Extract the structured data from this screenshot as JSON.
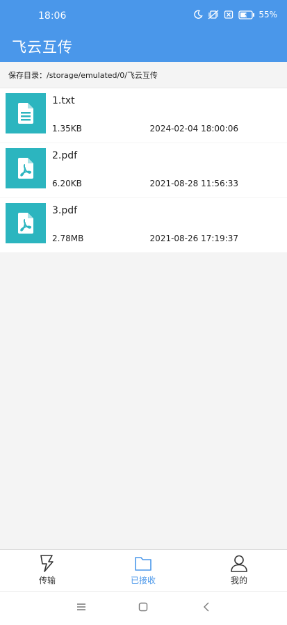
{
  "status_bar": {
    "time": "18:06",
    "battery_percent": "55%",
    "icons": [
      "moon-icon",
      "mute-vibrate-icon",
      "sim-off-icon",
      "battery-charging-icon"
    ]
  },
  "app": {
    "title": "飞云互传"
  },
  "save_directory": {
    "label": "保存目录：/storage/emulated/0/飞云互传"
  },
  "files": [
    {
      "name": "1.txt",
      "size": "1.35KB",
      "date": "2024-02-04 18:00:06",
      "icon": "text-file-icon"
    },
    {
      "name": "2.pdf",
      "size": "6.20KB",
      "date": "2021-08-28 11:56:33",
      "icon": "pdf-file-icon"
    },
    {
      "name": "3.pdf",
      "size": "2.78MB",
      "date": "2021-08-26 17:19:37",
      "icon": "pdf-file-icon"
    }
  ],
  "bottom_nav": {
    "items": [
      {
        "label": "传输",
        "icon": "lightning-icon",
        "active": false
      },
      {
        "label": "已接收",
        "icon": "folder-icon",
        "active": true
      },
      {
        "label": "我的",
        "icon": "person-icon",
        "active": false
      }
    ]
  },
  "colors": {
    "header": "#4a97ea",
    "file_icon_bg": "#2cb5bf",
    "active_tab": "#4a97ea"
  }
}
